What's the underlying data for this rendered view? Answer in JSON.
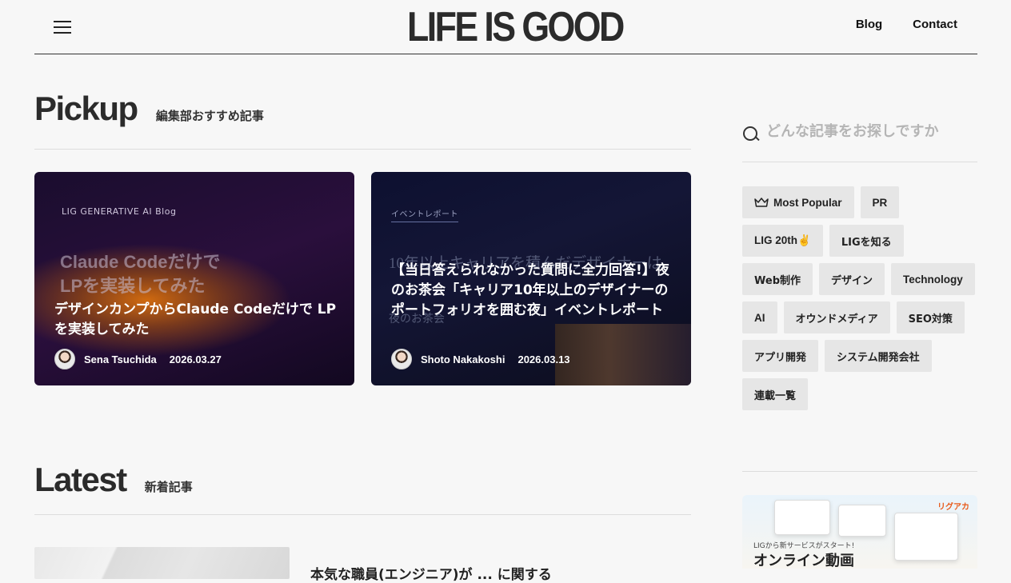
{
  "header": {
    "logo": "LIFE IS GOOD",
    "nav": [
      "Blog",
      "Contact"
    ]
  },
  "pickup": {
    "title": "Pickup",
    "subtitle": "編集部おすすめ記事",
    "cards": [
      {
        "tag": "LIG GENERATIVE AI Blog",
        "ghost_line1": "Claude Codeだけで",
        "ghost_line2": "LPを実装してみた",
        "title": "デザインカンプからClaude Codeだけで LPを実装してみた",
        "author": "Sena Tsuchida",
        "date": "2026.03.27"
      },
      {
        "tag": "イベントレポート",
        "ghost_line1": "10年以上キャリアを積んだデザイナーは",
        "ghost_line2": "夜のお茶会",
        "title": "【当日答えられなかった質問に全力回答!】夜のお茶会「キャリア10年以上のデザイナーのポートフォリオを囲む夜」イベントレポート",
        "author": "Shoto Nakakoshi",
        "date": "2026.03.13"
      }
    ]
  },
  "latest": {
    "title": "Latest",
    "subtitle": "新着記事",
    "first_title_partial": "本気な職員(エンジニア)が ... に関する"
  },
  "sidebar": {
    "search_placeholder": "どんな記事をお探しですか",
    "chips": [
      {
        "label": "Most Popular",
        "icon": "crown-icon"
      },
      {
        "label": "PR"
      },
      {
        "label": "LIG 20th✌️"
      },
      {
        "label": "LIGを知る"
      },
      {
        "label": "Web制作"
      },
      {
        "label": "デザイン"
      },
      {
        "label": "Technology"
      },
      {
        "label": "AI"
      },
      {
        "label": "オウンドメディア"
      },
      {
        "label": "SEO対策"
      },
      {
        "label": "アプリ開発"
      },
      {
        "label": "システム開発会社"
      },
      {
        "label": "連載一覧"
      }
    ],
    "ad": {
      "brand": "リグアカ",
      "small_text": "LIGから新サービスがスタート!",
      "big_text": "オンライン動画"
    }
  },
  "colors": {
    "background": "#f7f7f7",
    "text": "#222222",
    "chip_bg": "#e6e6e6",
    "placeholder": "#b5b5b5"
  }
}
